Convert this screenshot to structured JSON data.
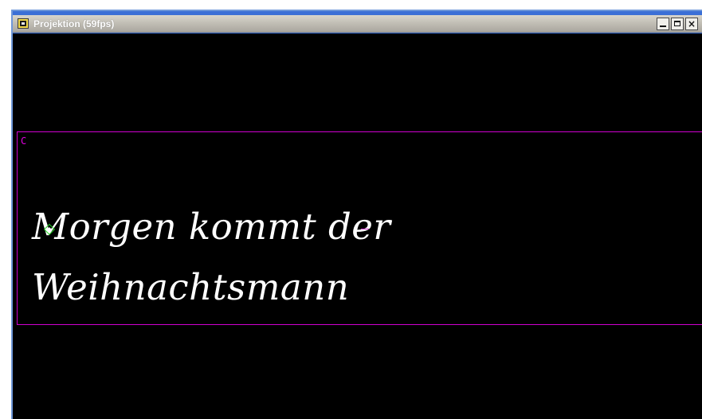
{
  "window": {
    "title": "Projektion (59fps)",
    "icon": "projector-app-icon",
    "buttons": {
      "minimize": "minimize-icon",
      "maximize": "maximize-icon",
      "close_glyph": "×"
    }
  },
  "projection": {
    "background_color": "#000000",
    "frame_color": "#d100d1",
    "box_label": "C",
    "lines": [
      "Morgen kommt der",
      "Weihnachtsmann"
    ]
  }
}
